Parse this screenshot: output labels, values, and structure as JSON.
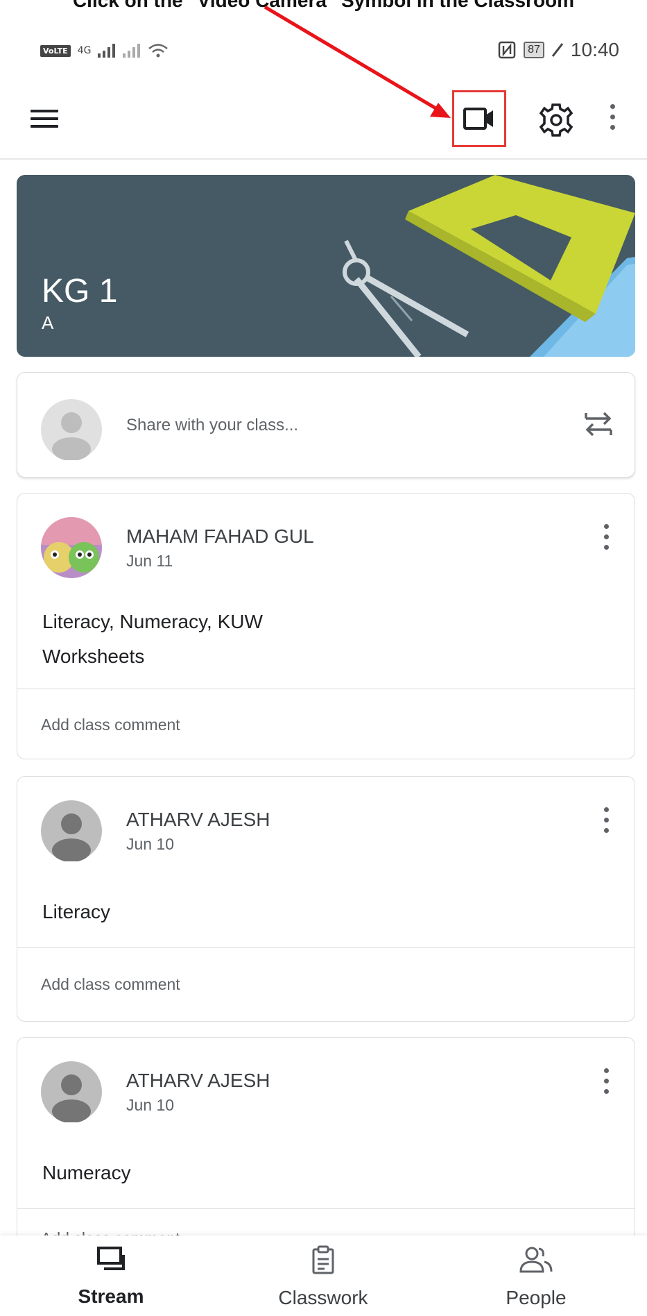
{
  "caption": "Click on the \"Video Camera\" Symbol in the Classroom",
  "status_bar": {
    "volte": "VoLTE",
    "network": "4G",
    "battery": "87",
    "time": "10:40"
  },
  "app_bar": {
    "menu_icon": "hamburger-menu-icon",
    "video_icon": "video-camera-icon",
    "settings_icon": "gear-icon",
    "more_icon": "more-vert-icon",
    "highlight_color": "#e53935"
  },
  "class_banner": {
    "title": "KG 1",
    "section": "A",
    "background_color": "#455a64"
  },
  "share_box": {
    "placeholder": "Share with your class...",
    "repost_icon": "repost-icon"
  },
  "posts": [
    {
      "author": "MAHAM FAHAD GUL",
      "date": "Jun 11",
      "lines": [
        "Literacy, Numeracy, KUW",
        "Worksheets"
      ],
      "comment_placeholder": "Add class comment"
    },
    {
      "author": "ATHARV AJESH",
      "date": "Jun 10",
      "lines": [
        "Literacy"
      ],
      "comment_placeholder": "Add class comment"
    },
    {
      "author": "ATHARV AJESH",
      "date": "Jun 10",
      "lines": [
        "Numeracy"
      ],
      "comment_placeholder": "Add class comment"
    }
  ],
  "bottom_nav": {
    "items": [
      {
        "label": "Stream",
        "icon": "stream-icon",
        "active": true
      },
      {
        "label": "Classwork",
        "icon": "clipboard-icon",
        "active": false
      },
      {
        "label": "People",
        "icon": "people-icon",
        "active": false
      }
    ]
  }
}
